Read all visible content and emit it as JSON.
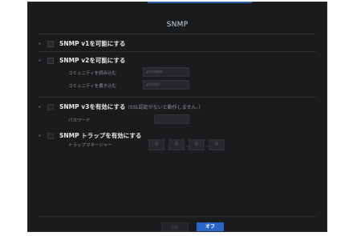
{
  "dialog": {
    "title": "SNMP",
    "ok_label": "OK",
    "cancel_label": "オフ"
  },
  "v1": {
    "label": "SNMP v1を可能にする"
  },
  "v2": {
    "label": "SNMP v2を可能にする",
    "read_label": "コミュニティを読み込む",
    "read_value": "private",
    "write_label": "コミュニティを書き込む",
    "write_value": "public"
  },
  "v3": {
    "label": "SNMP v3を有効にする",
    "note": "(SSL認証がないと動作しません。)",
    "password_label": "パスワード",
    "password_value": ""
  },
  "trap": {
    "label": "SNMP トラップを有効にする",
    "manager_label": "トラップマネージャー",
    "ip": [
      "0",
      "0",
      "0",
      "0"
    ]
  },
  "colors": {
    "accent": "#2a64c9",
    "background": "#1a1b1d"
  }
}
